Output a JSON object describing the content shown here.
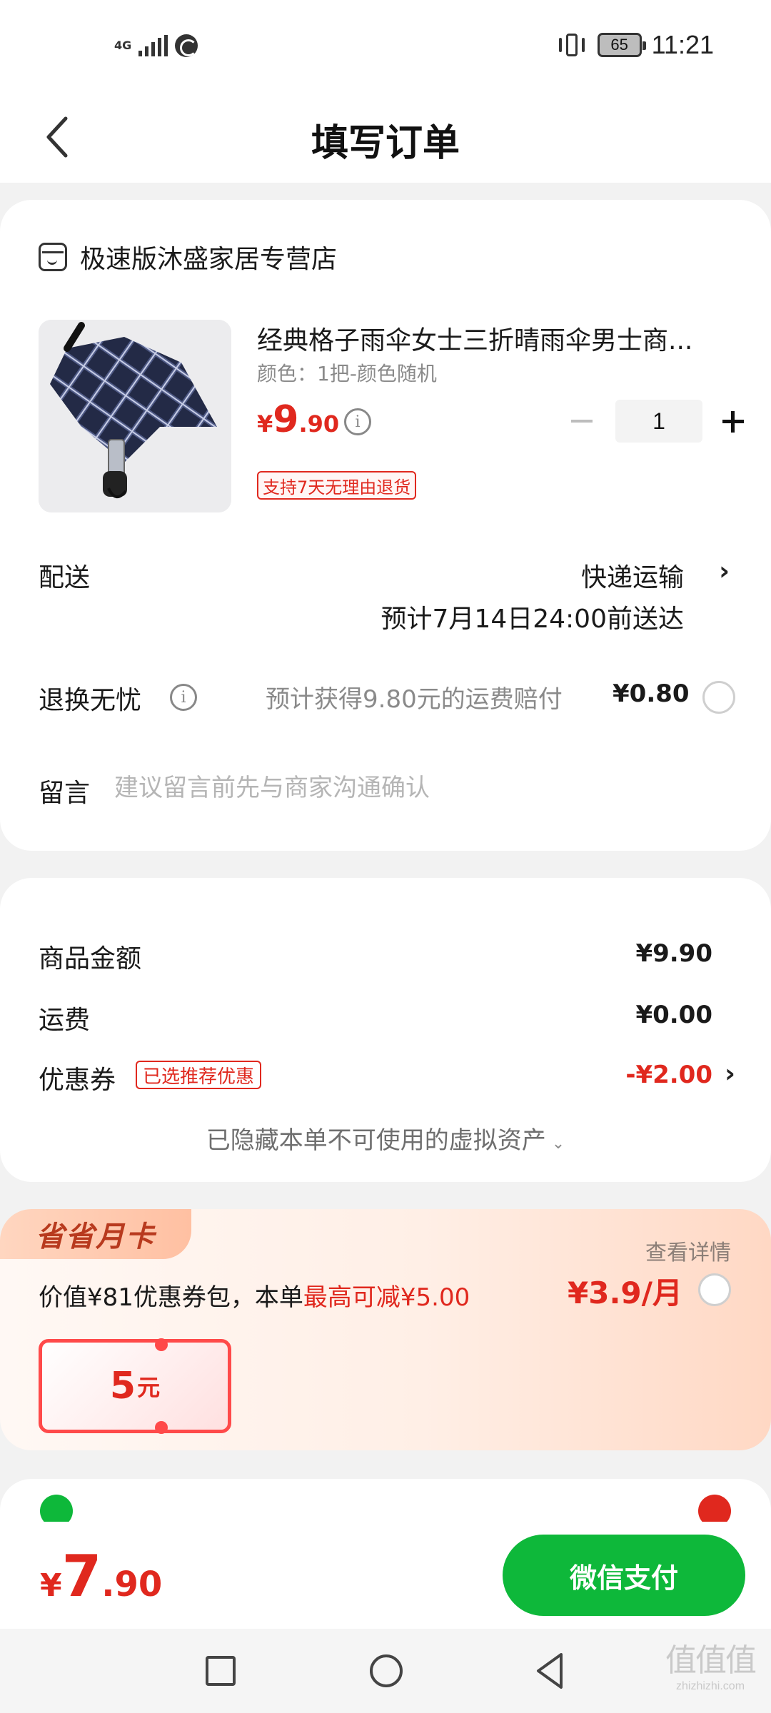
{
  "status_bar": {
    "network": "4G",
    "battery": "65",
    "time": "11:21"
  },
  "header": {
    "title": "填写订单"
  },
  "store": {
    "name": "极速版沐盛家居专营店"
  },
  "product": {
    "title": "经典格子雨伞女士三折晴雨伞男士商...",
    "spec": "颜色：1把-颜色随机",
    "price_symbol": "¥",
    "price_int": "9",
    "price_dec": ".90",
    "quantity": "1",
    "return_policy": "支持7天无理由退货"
  },
  "delivery": {
    "label": "配送",
    "method": "快递运输",
    "eta": "预计7月14日24:00前送达"
  },
  "worry_free": {
    "label": "退换无忧",
    "description": "预计获得9.80元的运费赔付",
    "price": "¥0.80"
  },
  "note": {
    "label": "留言",
    "placeholder": "建议留言前先与商家沟通确认"
  },
  "summary": {
    "goods_label": "商品金额",
    "goods_value": "¥9.90",
    "shipping_label": "运费",
    "shipping_value": "¥0.00",
    "coupon_label": "优惠券",
    "coupon_badge": "已选推荐优惠",
    "coupon_value": "-¥2.00",
    "hidden_assets": "已隐藏本单不可使用的虚拟资产"
  },
  "promo": {
    "tag": "省省月卡",
    "view_detail": "查看详情",
    "desc_prefix": "价值¥81优惠券包，本单",
    "desc_highlight": "最高可减¥5.00",
    "price": "¥3.9/月",
    "ticket_amount": "5",
    "ticket_unit": "元"
  },
  "bottom": {
    "total_symbol": "¥",
    "total_int": "7",
    "total_dec": ".90",
    "pay_label": "微信支付"
  },
  "watermark": {
    "main": "值值值",
    "sub": "zhizhizhi.com"
  },
  "colors": {
    "accent_red": "#e0281e",
    "pay_green": "#0eb83a"
  }
}
